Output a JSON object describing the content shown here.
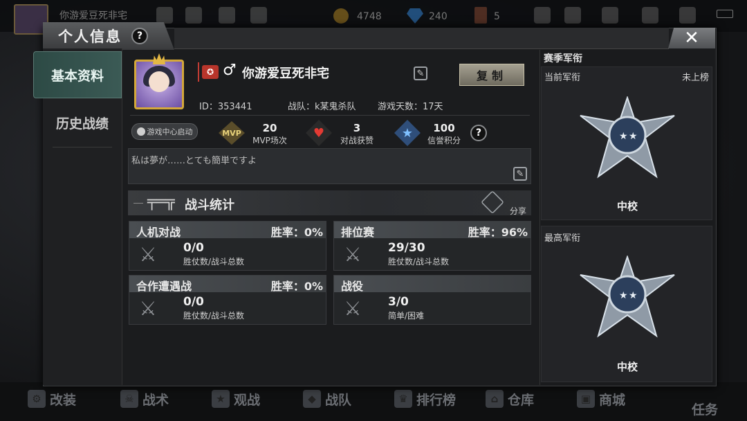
{
  "topbar": {
    "player_name": "你游爱豆死非宅",
    "gold": "4748",
    "diamond": "240",
    "tickets": "5"
  },
  "dialog": {
    "title": "个人信息",
    "help": "?",
    "close": "✕"
  },
  "nav": {
    "items": [
      {
        "label": "基本资料"
      },
      {
        "label": "历史战绩"
      }
    ]
  },
  "profile": {
    "gender_symbol": "♂",
    "name": "你游爱豆死非宅",
    "copy_label": "复制",
    "id_text": "ID：353441",
    "team_text": "战队：k某鬼杀队",
    "days_text": "游戏天数：17天",
    "launch_label": "游戏中心启动",
    "signature": "私は夢が……とても簡単ですよ"
  },
  "stats": [
    {
      "icon": "mvp-icon",
      "value": "20",
      "label": "MVP场次"
    },
    {
      "icon": "heart-icon",
      "value": "3",
      "label": "对战获赞"
    },
    {
      "icon": "star-icon",
      "value": "100",
      "label": "信誉积分"
    }
  ],
  "battle": {
    "title": "战斗统计",
    "share_label": "分享",
    "cards": [
      {
        "category": "人机对战",
        "rate": "胜率：0%",
        "value": "0/0",
        "sub": "胜仗数/战斗总数"
      },
      {
        "category": "排位赛",
        "rate": "胜率：96%",
        "value": "29/30",
        "sub": "胜仗数/战斗总数"
      },
      {
        "category": "合作遭遇战",
        "rate": "胜率：0%",
        "value": "0/0",
        "sub": "胜仗数/战斗总数"
      },
      {
        "category": "战役",
        "rate": "",
        "value": "3/0",
        "sub": "简单/困难"
      }
    ]
  },
  "rank": {
    "section_title": "赛季军衔",
    "current_label": "当前军衔",
    "current_status": "未上榜",
    "current_rank": "中校",
    "highest_label": "最高军衔",
    "highest_rank": "中校"
  },
  "bottom_nav": [
    {
      "label": "改装"
    },
    {
      "label": "战术"
    },
    {
      "label": "观战"
    },
    {
      "label": "战队"
    },
    {
      "label": "排行榜"
    },
    {
      "label": "仓库"
    },
    {
      "label": "商城"
    },
    {
      "label": "任务"
    }
  ]
}
